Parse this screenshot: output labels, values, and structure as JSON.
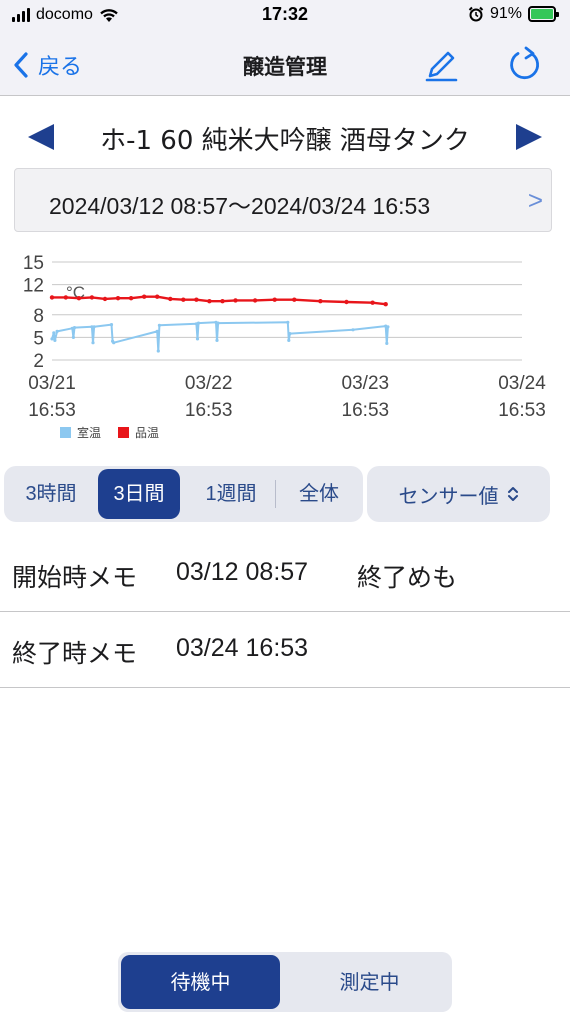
{
  "status_bar": {
    "carrier": "docomo",
    "time": "17:32",
    "battery": "91%"
  },
  "nav": {
    "back_label": "戻る",
    "title": "醸造管理"
  },
  "tank": {
    "name": "ホ-1 60 純米大吟醸 酒母タンク"
  },
  "period": {
    "range": "2024/03/12 08:57～2024/03/24 16:53",
    "next": ">"
  },
  "chart_data": {
    "type": "line",
    "unit_label": "°C",
    "y_ticks": [
      "15",
      "12",
      "8",
      "5",
      "2"
    ],
    "ylim": [
      2,
      15
    ],
    "x_ticks": [
      {
        "date": "03/21",
        "time": "16:53"
      },
      {
        "date": "03/22",
        "time": "16:53"
      },
      {
        "date": "03/23",
        "time": "16:53"
      },
      {
        "date": "03/24",
        "time": "16:53"
      }
    ],
    "xlim": [
      "03/21 16:53",
      "03/24 16:53"
    ],
    "grid": true,
    "legend_position": "bottom-left",
    "series": [
      {
        "name": "品温",
        "color": "#e8151a",
        "points": [
          [
            "03/21 16:53",
            10.3
          ],
          [
            "03/21 19:00",
            10.3
          ],
          [
            "03/21 21:00",
            10.2
          ],
          [
            "03/21 23:00",
            10.3
          ],
          [
            "03/22 01:00",
            10.1
          ],
          [
            "03/22 03:00",
            10.2
          ],
          [
            "03/22 05:00",
            10.2
          ],
          [
            "03/22 07:00",
            10.4
          ],
          [
            "03/22 09:00",
            10.4
          ],
          [
            "03/22 11:00",
            10.1
          ],
          [
            "03/22 13:00",
            10.0
          ],
          [
            "03/22 15:00",
            10.0
          ],
          [
            "03/22 17:00",
            9.8
          ],
          [
            "03/22 19:00",
            9.8
          ],
          [
            "03/22 21:00",
            9.9
          ],
          [
            "03/23 00:00",
            9.9
          ],
          [
            "03/23 03:00",
            10.0
          ],
          [
            "03/23 06:00",
            10.0
          ],
          [
            "03/23 10:00",
            9.8
          ],
          [
            "03/23 14:00",
            9.7
          ],
          [
            "03/23 18:00",
            9.6
          ],
          [
            "03/23 20:00",
            9.4
          ]
        ]
      },
      {
        "name": "室温",
        "color": "#8cc8f0",
        "points": [
          [
            "03/21 16:53",
            4.8
          ],
          [
            "03/21 17:10",
            5.6
          ],
          [
            "03/21 17:20",
            4.6
          ],
          [
            "03/21 17:40",
            5.8
          ],
          [
            "03/21 20:00",
            6.2
          ],
          [
            "03/21 20:10",
            5.0
          ],
          [
            "03/21 20:20",
            6.3
          ],
          [
            "03/21 23:00",
            6.4
          ],
          [
            "03/21 23:10",
            4.3
          ],
          [
            "03/21 23:20",
            6.4
          ],
          [
            "03/22 02:00",
            6.7
          ],
          [
            "03/22 02:10",
            4.5
          ],
          [
            "03/22 02:20",
            4.3
          ],
          [
            "03/22 09:00",
            5.8
          ],
          [
            "03/22 09:10",
            3.2
          ],
          [
            "03/22 09:20",
            6.6
          ],
          [
            "03/22 15:00",
            6.8
          ],
          [
            "03/22 15:10",
            4.8
          ],
          [
            "03/22 15:20",
            6.9
          ],
          [
            "03/22 18:00",
            7.0
          ],
          [
            "03/22 18:10",
            4.6
          ],
          [
            "03/22 18:20",
            6.9
          ],
          [
            "03/23 05:00",
            7.0
          ],
          [
            "03/23 05:10",
            4.6
          ],
          [
            "03/23 05:20",
            5.5
          ],
          [
            "03/23 15:00",
            6.0
          ],
          [
            "03/23 20:00",
            6.5
          ],
          [
            "03/23 20:10",
            4.2
          ],
          [
            "03/23 20:20",
            6.4
          ]
        ]
      }
    ],
    "legend": [
      {
        "name": "室温",
        "color": "#8cc8f0"
      },
      {
        "name": "品温",
        "color": "#e8151a"
      }
    ]
  },
  "range_tabs": {
    "items": [
      "3時間",
      "3日間",
      "1週間",
      "全体"
    ],
    "selected": "3日間"
  },
  "sensor_select": {
    "value": "センサー値"
  },
  "memos": {
    "start_label": "開始時メモ",
    "start_time": "03/12 08:57",
    "start_text": "終了めも",
    "end_label": "終了時メモ",
    "end_time": "03/24 16:53",
    "end_text": ""
  },
  "mode_toggle": {
    "standby": "待機中",
    "measuring": "測定中",
    "selected": "待機中"
  },
  "colors": {
    "accent": "#1e3f8f",
    "link": "#1a73e8",
    "product_temp": "#e8151a",
    "room_temp": "#8cc8f0"
  },
  "icons": {
    "back": "chevron-left-icon",
    "edit": "pencil-icon",
    "refresh": "refresh-icon",
    "prev_tank": "triangle-left-icon",
    "next_tank": "triangle-right-icon",
    "sensor_dropdown": "chevron-updown-icon"
  }
}
